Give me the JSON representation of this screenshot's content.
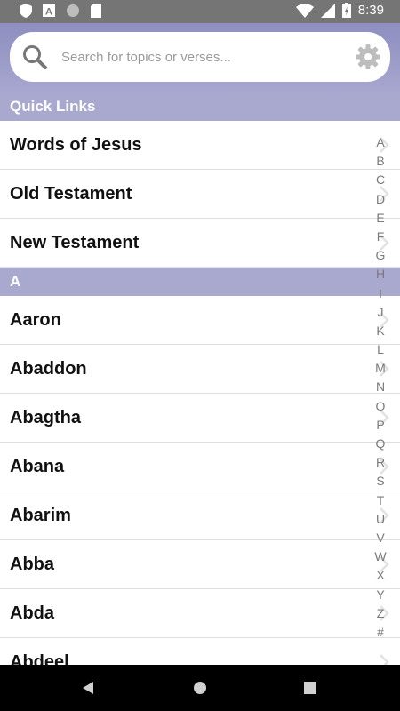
{
  "status_bar": {
    "time": "8:39"
  },
  "search": {
    "placeholder": "Search for topics or verses..."
  },
  "sections": {
    "quick_links": {
      "title": "Quick Links",
      "items": [
        "Words of Jesus",
        "Old Testament",
        "New Testament"
      ]
    },
    "a": {
      "title": "A",
      "items": [
        "Aaron",
        "Abaddon",
        "Abagtha",
        "Abana",
        "Abarim",
        "Abba",
        "Abda",
        "Abdeel"
      ]
    }
  },
  "index_letters": [
    "A",
    "B",
    "C",
    "D",
    "E",
    "F",
    "G",
    "H",
    "I",
    "J",
    "K",
    "L",
    "M",
    "N",
    "O",
    "P",
    "Q",
    "R",
    "S",
    "T",
    "U",
    "V",
    "W",
    "X",
    "Y",
    "Z",
    "#"
  ],
  "colors": {
    "header": "#a7a7d0",
    "section_header": "#a9a9cf",
    "status_bar": "#757575"
  }
}
